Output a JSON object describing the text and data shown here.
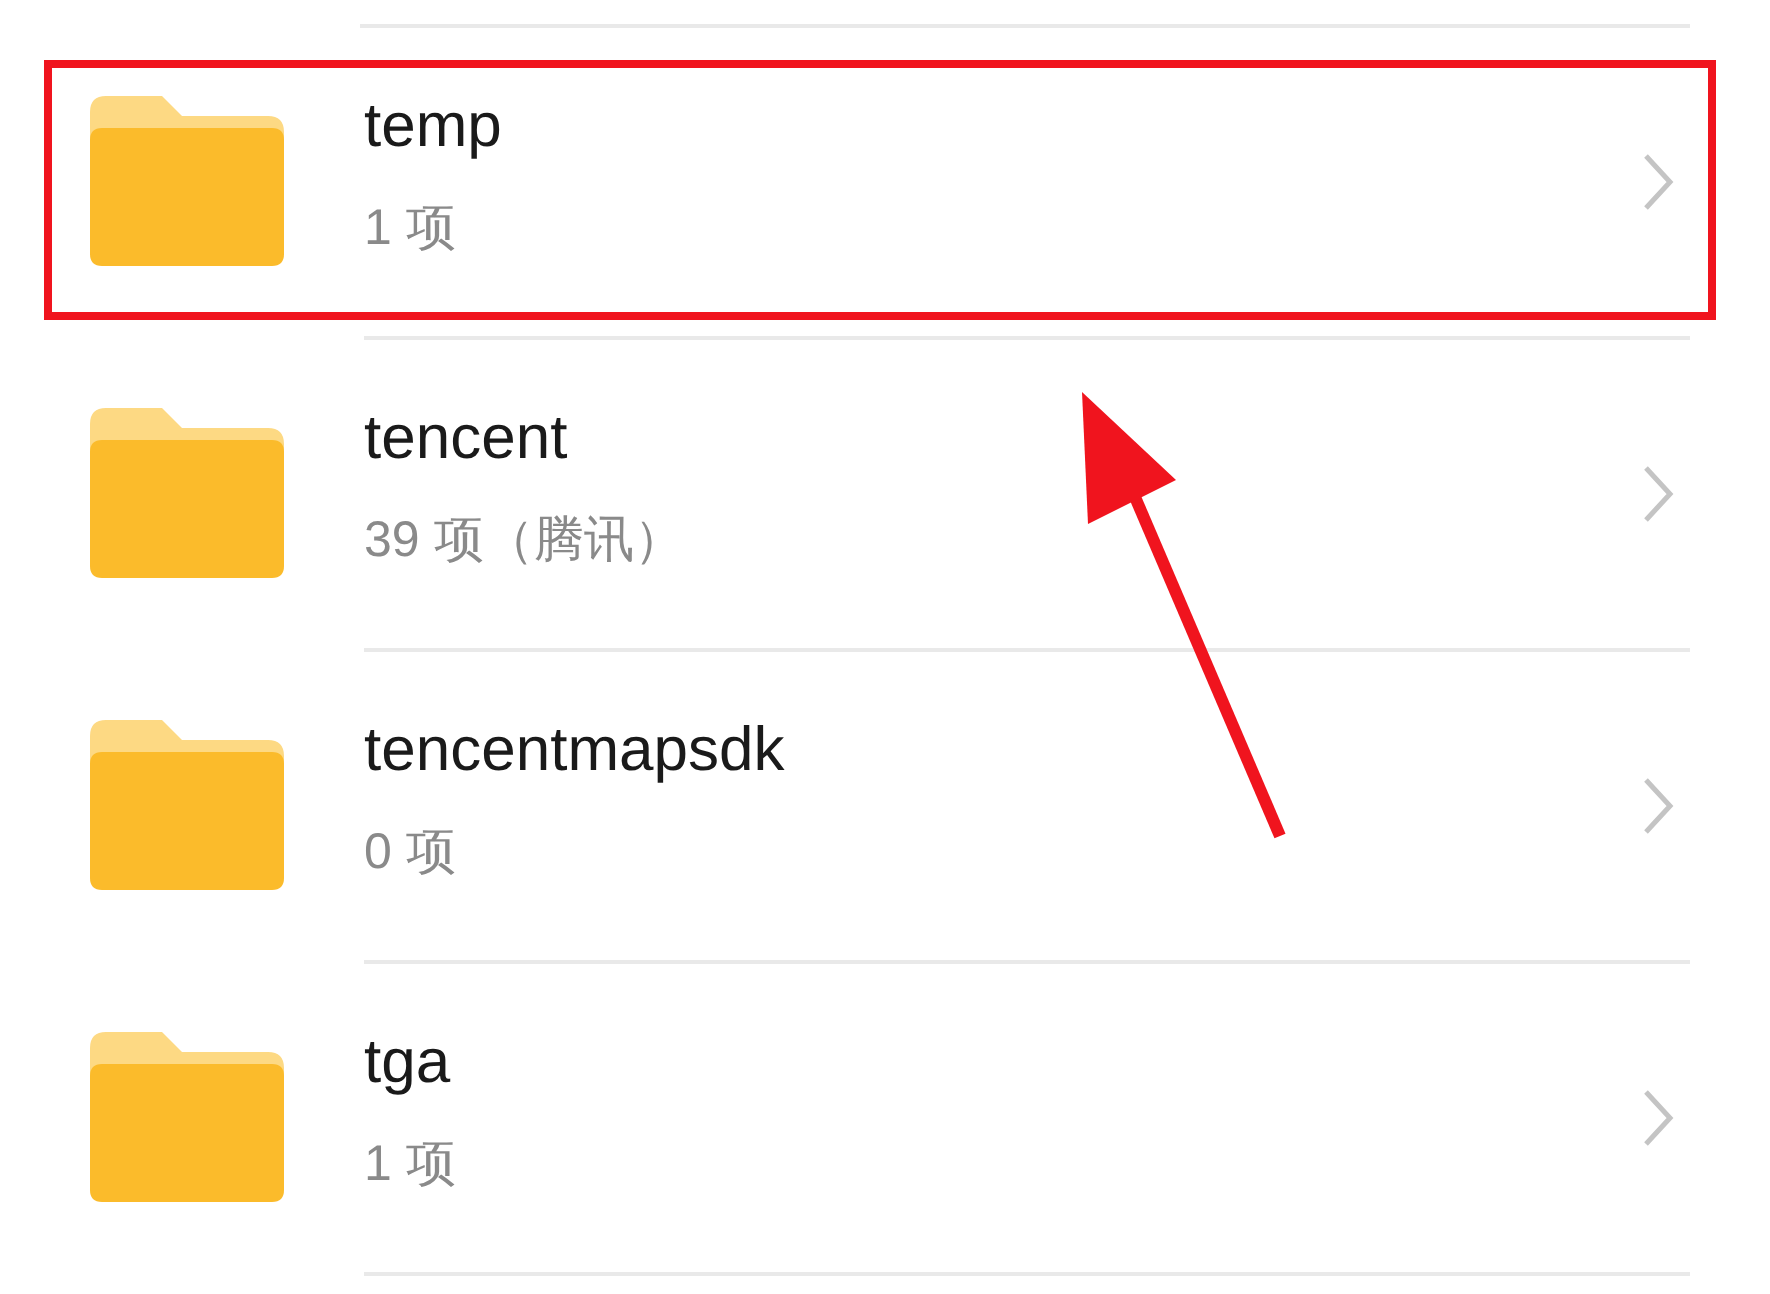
{
  "folders": [
    {
      "name": "temp",
      "detail": "1 项",
      "highlighted": true
    },
    {
      "name": "tencent",
      "detail": "39 项（腾讯）",
      "highlighted": false
    },
    {
      "name": "tencentmapsdk",
      "detail": "0 项",
      "highlighted": false
    },
    {
      "name": "tga",
      "detail": "1 项",
      "highlighted": false
    }
  ]
}
